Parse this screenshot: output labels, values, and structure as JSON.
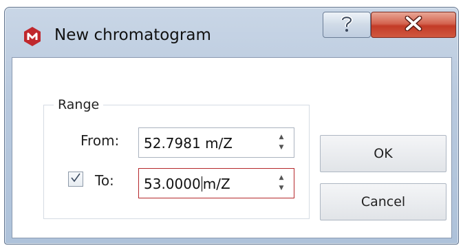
{
  "window": {
    "title": "New chromatogram",
    "help_glyph": "?",
    "close_glyph": "X"
  },
  "range_group": {
    "label": "Range",
    "from": {
      "label": "From:",
      "value": "52.7981",
      "unit": "m/Z"
    },
    "to": {
      "label": "To:",
      "checked": true,
      "value": "53.0000",
      "unit": "m/Z"
    }
  },
  "buttons": {
    "ok_label": "OK",
    "cancel_label": "Cancel"
  },
  "icons": {
    "app": "app-logo-icon",
    "help": "help-icon",
    "close": "close-icon",
    "spin_up": "chevron-up-icon",
    "spin_down": "chevron-down-icon",
    "check": "checkmark-icon"
  },
  "colors": {
    "app_icon": "#c0282d",
    "close_button": "#c9432e",
    "focus_border": "#b5272b"
  }
}
